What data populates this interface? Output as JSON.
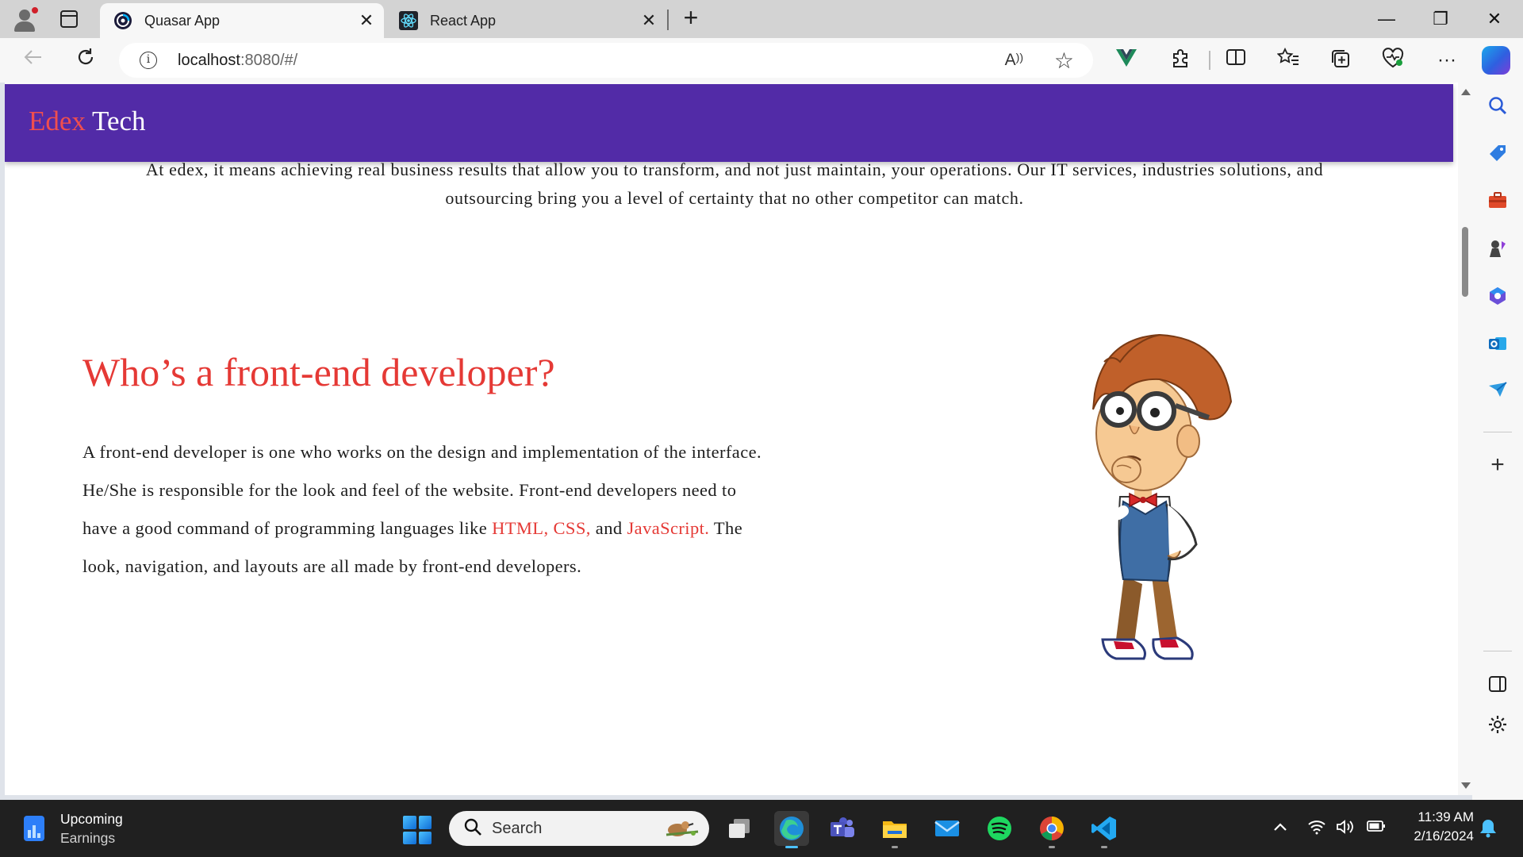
{
  "browser": {
    "tabs": [
      {
        "title": "Quasar App",
        "active": true
      },
      {
        "title": "React App",
        "active": false
      }
    ],
    "close_glyph": "✕",
    "new_tab_glyph": "+",
    "window_controls": {
      "minimize": "—",
      "restore": "❐",
      "close": "✕"
    },
    "address": {
      "host": "localhost",
      "path": ":8080/#/"
    },
    "icons": [
      "back-icon",
      "refresh-icon",
      "info-icon",
      "read-aloud-icon",
      "favorite-star-icon",
      "vue-devtools-icon",
      "extensions-icon",
      "split-screen-icon",
      "favorites-icon",
      "collections-icon",
      "browser-essentials-icon",
      "more-icon",
      "copilot-icon"
    ]
  },
  "sidebar": {
    "icons": [
      "search-icon",
      "shopping-tag-icon",
      "tools-icon",
      "games-icon",
      "microsoft-365-icon",
      "outlook-icon",
      "send-icon",
      "add-icon",
      "sidebar-toggle-icon",
      "settings-icon"
    ]
  },
  "page": {
    "brand": {
      "part1": "Edex",
      "part2": "Tech"
    },
    "brand_colors": {
      "accent": "#f04e4e",
      "header_bg": "#522ba7"
    },
    "intro_text": "At edex, it means achieving real business results that allow you to transform, and not just maintain, your operations. Our IT services, industries solutions, and outsourcing bring you a level of certainty that no other competitor can match.",
    "heading": "Who’s a front-end developer?",
    "paragraph": {
      "part1": "A front-end developer is one who works on the design and implementation of the interface. He/She is responsible for the look and feel of the website. Front-end developers need to have a good command of programming languages like ",
      "link1": "HTML,",
      "link2": "CSS,",
      "and_text": " and ",
      "link3": "JavaScript.",
      "part2": " The look, navigation, and layouts are all made by front-end developers."
    },
    "illustration": "thinking-developer-cartoon"
  },
  "taskbar": {
    "widget": {
      "line1": "Upcoming",
      "line2": "Earnings"
    },
    "search_label": "Search",
    "apps": [
      "task-view-icon",
      "edge-icon",
      "teams-icon",
      "file-explorer-icon",
      "mail-icon",
      "spotify-icon",
      "chrome-icon",
      "vscode-icon"
    ],
    "clock": {
      "time": "11:39 AM",
      "date": "2/16/2024"
    }
  }
}
